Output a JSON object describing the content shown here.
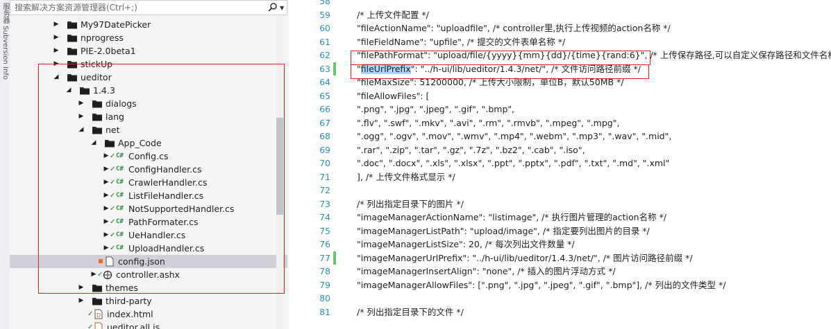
{
  "left_strip": {
    "labels": "服务器  Subversion Info"
  },
  "search": {
    "placeholder": "搜索解决方案资源管理器(Ctrl+;)"
  },
  "tree": [
    {
      "label": "My97DatePicker",
      "depth": 0,
      "kind": "folder",
      "expander": "▶"
    },
    {
      "label": "nprogress",
      "depth": 0,
      "kind": "folder",
      "expander": "▶"
    },
    {
      "label": "PIE-2.0beta1",
      "depth": 0,
      "kind": "folder",
      "expander": "▶"
    },
    {
      "label": "stickUp",
      "depth": 0,
      "kind": "folder",
      "expander": "▶"
    },
    {
      "label": "ueditor",
      "depth": 0,
      "kind": "folder",
      "expander": "◢"
    },
    {
      "label": "1.4.3",
      "depth": 1,
      "kind": "folder",
      "expander": "◢"
    },
    {
      "label": "dialogs",
      "depth": 2,
      "kind": "folder",
      "expander": "▶"
    },
    {
      "label": "lang",
      "depth": 2,
      "kind": "folder",
      "expander": "▶"
    },
    {
      "label": "net",
      "depth": 2,
      "kind": "folder",
      "expander": "◢"
    },
    {
      "label": "App_Code",
      "depth": 3,
      "kind": "folder",
      "expander": "◢"
    },
    {
      "label": "Config.cs",
      "depth": 4,
      "kind": "cs",
      "expander": "▶"
    },
    {
      "label": "ConfigHandler.cs",
      "depth": 4,
      "kind": "cs",
      "expander": "▶"
    },
    {
      "label": "CrawlerHandler.cs",
      "depth": 4,
      "kind": "cs",
      "expander": "▶"
    },
    {
      "label": "ListFileHandler.cs",
      "depth": 4,
      "kind": "cs",
      "expander": "▶"
    },
    {
      "label": "NotSupportedHandler.cs",
      "depth": 4,
      "kind": "cs",
      "expander": "▶"
    },
    {
      "label": "PathFormater.cs",
      "depth": 4,
      "kind": "cs",
      "expander": "▶"
    },
    {
      "label": "UeHandler.cs",
      "depth": 4,
      "kind": "cs",
      "expander": "▶"
    },
    {
      "label": "UploadHandler.cs",
      "depth": 4,
      "kind": "cs",
      "expander": "▶"
    },
    {
      "label": "config.json",
      "depth": 3,
      "kind": "file",
      "expander": "",
      "selected": true
    },
    {
      "label": "controller.ashx",
      "depth": 3,
      "kind": "ashx",
      "expander": "▶"
    },
    {
      "label": "themes",
      "depth": 2,
      "kind": "folder",
      "expander": "▶"
    },
    {
      "label": "third-party",
      "depth": 2,
      "kind": "folder",
      "expander": "▶"
    },
    {
      "label": "index.html",
      "depth": 2,
      "kind": "html",
      "expander": ""
    },
    {
      "label": "ueditor.all.js",
      "depth": 2,
      "kind": "js",
      "expander": ""
    }
  ],
  "code_lines": [
    {
      "ln": "58",
      "text": ""
    },
    {
      "ln": "59",
      "text": "/* 上传文件配置 */"
    },
    {
      "ln": "60",
      "text": "\"fileActionName\": \"uploadfile\", /* controller里,执行上传视频的action名称 */"
    },
    {
      "ln": "61",
      "text": "\"fileFieldName\": \"upfile\", /* 提交的文件表单名称 */"
    },
    {
      "ln": "62",
      "text": "\"filePathFormat\": \"upload/file/{yyyy}{mm}{dd}/{time}{rand:6}\", /* 上传保存路径,可以自定义保存路径和文件名格式 */"
    },
    {
      "ln": "63",
      "pre": "",
      "highlight": "fileUrlPrefix",
      "text": "\"fileUrlPrefix\": \"../h-ui/lib/ueditor/1.4.3/net/\", /* 文件访问路径前缀 */",
      "changed": true
    },
    {
      "ln": "64",
      "text": "\"fileMaxSize\": 51200000, /* 上传大小限制，单位B，默认50MB */"
    },
    {
      "ln": "65",
      "text": "\"fileAllowFiles\": ["
    },
    {
      "ln": "66",
      "text": "    \".png\", \".jpg\", \".jpeg\", \".gif\", \".bmp\","
    },
    {
      "ln": "67",
      "text": "    \".flv\", \".swf\", \".mkv\", \".avi\", \".rm\", \".rmvb\", \".mpeg\", \".mpg\","
    },
    {
      "ln": "68",
      "text": "    \".ogg\", \".ogv\", \".mov\", \".wmv\", \".mp4\", \".webm\", \".mp3\", \".wav\", \".mid\","
    },
    {
      "ln": "69",
      "text": "    \".rar\", \".zip\", \".tar\", \".gz\", \".7z\", \".bz2\", \".cab\", \".iso\","
    },
    {
      "ln": "70",
      "text": "    \".doc\", \".docx\", \".xls\", \".xlsx\", \".ppt\", \".pptx\", \".pdf\", \".txt\", \".md\", \".xml\""
    },
    {
      "ln": "71",
      "text": "], /* 上传文件格式显示 */"
    },
    {
      "ln": "72",
      "text": ""
    },
    {
      "ln": "73",
      "text": "/* 列出指定目录下的图片 */"
    },
    {
      "ln": "74",
      "text": "\"imageManagerActionName\": \"listimage\", /* 执行图片管理的action名称 */"
    },
    {
      "ln": "75",
      "text": "\"imageManagerListPath\": \"upload/image\", /* 指定要列出图片的目录 */"
    },
    {
      "ln": "76",
      "text": "\"imageManagerListSize\": 20, /* 每次列出文件数量 */"
    },
    {
      "ln": "77",
      "text": "\"imageManagerUrlPrefix\": \"../h-ui/lib/ueditor/1.4.3/net/\", /* 图片访问路径前缀 */",
      "changed": true
    },
    {
      "ln": "78",
      "text": "\"imageManagerInsertAlign\": \"none\", /* 插入的图片浮动方式 */"
    },
    {
      "ln": "79",
      "text": "\"imageManagerAllowFiles\": [\".png\", \".jpg\", \".jpeg\", \".gif\", \".bmp\"], /* 列出的文件类型 */"
    },
    {
      "ln": "80",
      "text": ""
    },
    {
      "ln": "81",
      "text": "/* 列出指定目录下的文件 */"
    }
  ],
  "colors": {
    "accent_red": "#e51c23",
    "selection": "#cfd0d8",
    "line_number": "#2b91af",
    "change_marker": "#6ac46a",
    "word_highlight": "#add6ff"
  }
}
